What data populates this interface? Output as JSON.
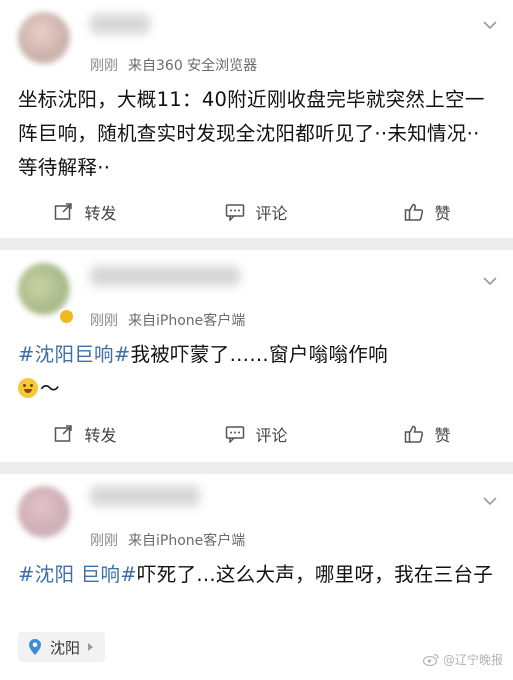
{
  "posts": [
    {
      "meta_time": "刚刚",
      "meta_source": "来自360 安全浏览器",
      "text": "坐标沈阳，大概11：40附近刚收盘完毕就突然上空一阵巨响，随机查实时发现全沈阳都听见了··未知情况··等待解释··",
      "actions": {
        "repost": "转发",
        "comment": "评论",
        "like": "赞"
      }
    },
    {
      "meta_time": "刚刚",
      "meta_source": "来自iPhone客户端",
      "topic1": "#沈阳巨响#",
      "text": "我被吓蒙了……窗户嗡嗡作响",
      "tail": "～",
      "actions": {
        "repost": "转发",
        "comment": "评论",
        "like": "赞"
      }
    },
    {
      "meta_time": "刚刚",
      "meta_source": "来自iPhone客户端",
      "topic1": "#沈阳 巨响#",
      "text": "吓死了...这么大声，哪里呀，我在三台子",
      "location": "沈阳"
    }
  ],
  "watermark": "@辽宁晚报",
  "icons": {
    "menu": "chevron-down-icon",
    "repost": "repost-icon",
    "comment": "comment-icon",
    "like": "thumbs-up-icon",
    "location": "location-pin-icon",
    "emoji": "laughing-crying-emoji"
  },
  "colors": {
    "topic": "#3f6ea8",
    "background": "#ececec",
    "card": "#ffffff",
    "meta": "#8b8b8b"
  }
}
